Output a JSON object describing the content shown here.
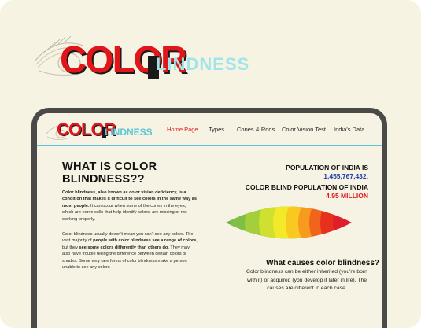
{
  "hero": {
    "logo_word_1": "COLOR",
    "logo_word_2": "LINDNESS"
  },
  "site": {
    "logo_word_1": "COLOR",
    "logo_word_2": "LINDNESS"
  },
  "nav": {
    "items": [
      {
        "label": "Home Page",
        "active": true
      },
      {
        "label": "Types"
      },
      {
        "label": "Cones & Rods"
      },
      {
        "label": "Color Vision Test"
      },
      {
        "label": "India's Data"
      }
    ]
  },
  "main": {
    "heading": "WHAT IS COLOR BLINDNESS??",
    "para1_bold": "Color blindness, also known as color vision deficiency, is a condition that makes it difficult to see colors in the same way as most people.",
    "para1_rest": " It can occur when some of the cones in the eyes, which are nerve cells that help identify colors, are missing or not working properly.",
    "para2_a": "Color blindness usually doesn't mean you can't see any colors. The vast majority of ",
    "para2_b1": "people with color blindness see a range of colors",
    "para2_c": ", but they ",
    "para2_b2": "see some colors differently than others do",
    "para2_d": ". They may also have trouble telling the difference between certain colors or shades. Some very rare forms of color blindness make a person unable to see any colors"
  },
  "stats": {
    "population_label": "POPULATION OF INDIA IS",
    "population_value": "1,455,767,432.",
    "color_blind_label": "COLOR BLIND POPULATION OF INDIA",
    "color_blind_value": "4.95 MILLION"
  },
  "causes": {
    "title": "What causes color blindness?",
    "text": "Color blindness can be either inherited (you're born with it) or acquired (you develop it later in life). The causes are different in each case."
  },
  "colors": {
    "accent_red": "#e0161b",
    "accent_cyan": "#5cc6d6",
    "accent_blue": "#1d3fa8",
    "background": "#f6f3e2"
  }
}
